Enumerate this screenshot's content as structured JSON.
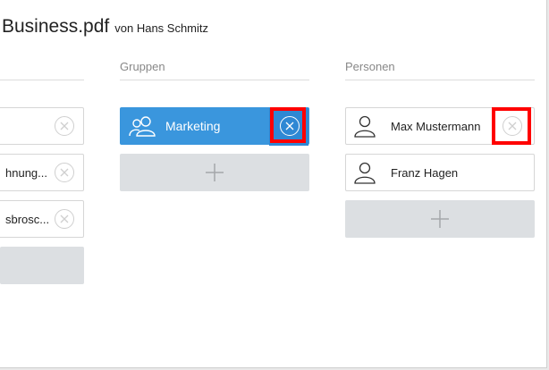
{
  "document": {
    "title": "Business.pdf",
    "author": "von Hans Schmitz"
  },
  "columns": {
    "left": {
      "items": [
        {
          "label": ""
        },
        {
          "label": "hnung..."
        },
        {
          "label": "sbrosc..."
        }
      ]
    },
    "groups": {
      "heading": "Gruppen",
      "items": [
        {
          "label": "Marketing"
        }
      ]
    },
    "persons": {
      "heading": "Personen",
      "items": [
        {
          "label": "Max Mustermann"
        },
        {
          "label": "Franz Hagen"
        }
      ]
    }
  },
  "colors": {
    "accent": "#3a96dd",
    "highlight": "#ff0000",
    "add_box": "#dcdfe2"
  }
}
